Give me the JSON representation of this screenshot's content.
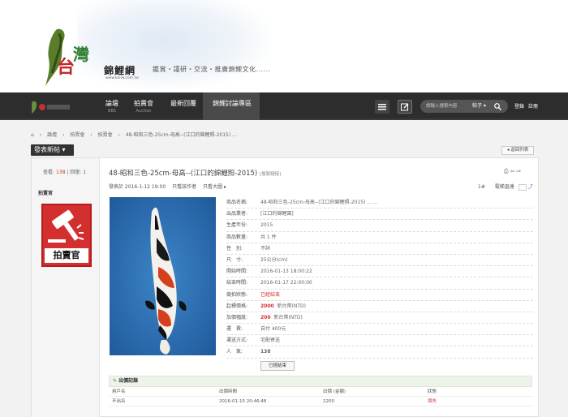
{
  "site": {
    "name": "錦鯉網",
    "url": "www.koiiw.com.tw",
    "slogan": "鑑賞・謹研・交流・推廣錦鯉文化......"
  },
  "nav": {
    "items": [
      {
        "label": "論壇",
        "sub": "BBS"
      },
      {
        "label": "拍賣會",
        "sub": "Auction"
      },
      {
        "label": "最新回覆",
        "sub": ""
      },
      {
        "label": "錦鯉討論專區",
        "sub": ""
      }
    ],
    "search_placeholder": "請輸入搜索內容",
    "search_type": "帖子 ▾",
    "login": "登錄",
    "register": "註冊"
  },
  "breadcrumb": [
    "論壇",
    "拍賣會",
    "拍賣會",
    "48-昭和三色-25cm-母高--(江口的錦鯉照-2015) ..."
  ],
  "actions": {
    "new_post": "發表新帖 ▾",
    "back": "◂ 返回列表"
  },
  "sidebar": {
    "views_label": "查看:",
    "views": "138",
    "replies_label": "回復:",
    "replies": "1",
    "author": "拍賣官",
    "badge_text": "拍賣官"
  },
  "post": {
    "title": "48-昭和三色-25cm-母高--(江口的錦鯉照-2015)",
    "title_tag": "[複製鏈接]",
    "meta": [
      "發表於 2016-1-12 19:00",
      "只看該作者",
      "只看大圖 ▸"
    ],
    "floor": "1#",
    "floor_link": "電梯直達"
  },
  "info": [
    {
      "key": "商品名稱:",
      "value": "48-昭和三色-25cm-母高--(江口的錦鯉照-2015) ... ..."
    },
    {
      "key": "出品業者:",
      "value": "[江口的錦鯉園]"
    },
    {
      "key": "生產年份:",
      "value": "2015"
    },
    {
      "key": "商品數量:",
      "value": "共 1 件"
    },
    {
      "key": "性　別:",
      "value": "不詳"
    },
    {
      "key": "尺　寸:",
      "value": "25公分(cm)"
    },
    {
      "key": "開始時間:",
      "value": "2016-01-13 18:00:22"
    },
    {
      "key": "結束時間:",
      "value": "2016-01-17 22:00:00"
    },
    {
      "key": "競拍狀態:",
      "value": "已經結束",
      "style": "red"
    },
    {
      "key": "起標價格:",
      "value": "2000",
      "suffix": "新台幣(NTD)",
      "style": "bold-red"
    },
    {
      "key": "加價幅度:",
      "value": "200",
      "suffix": "新台幣(NTD)",
      "style": "bold-red"
    },
    {
      "key": "運　費:",
      "value": "自付 400元"
    },
    {
      "key": "運送方式:",
      "value": "宅配寄送"
    },
    {
      "key": "人　氣:",
      "value": "138",
      "style": "bold-red"
    }
  ],
  "ended_button": "已經結束",
  "bids": {
    "title": "出價記錄",
    "columns": [
      "用戶名",
      "出價時間",
      "出價 (金額)",
      "狀態"
    ],
    "rows": [
      [
        "不出名",
        "2016-01-15 20:46:48",
        "2200",
        "領先"
      ]
    ]
  },
  "colors": {
    "accent_red": "#d32f2f",
    "nav_bg": "#2d2d2d"
  }
}
